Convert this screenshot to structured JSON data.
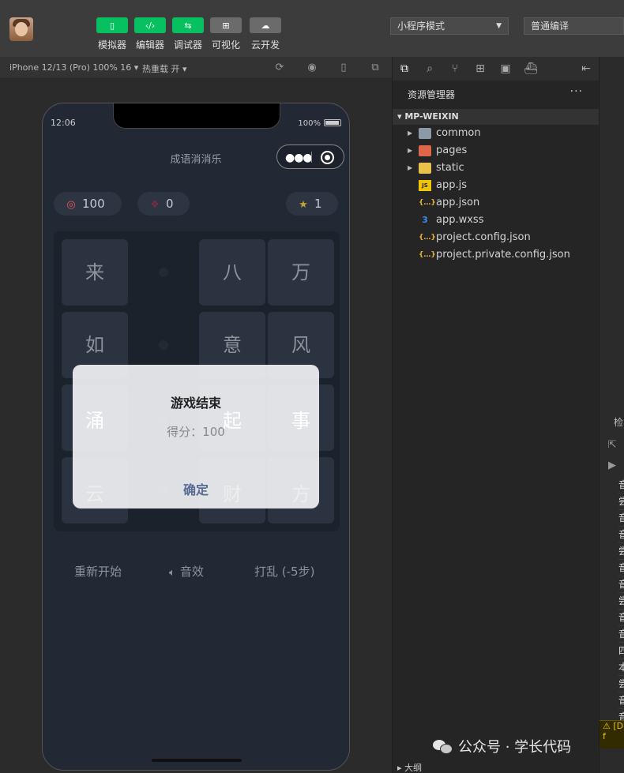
{
  "toolbar": {
    "tools": [
      {
        "label": "模拟器",
        "icon": "phone-icon"
      },
      {
        "label": "编辑器",
        "icon": "code-icon"
      },
      {
        "label": "调试器",
        "icon": "debug-icon"
      },
      {
        "label": "可视化",
        "icon": "layout-icon"
      },
      {
        "label": "云开发",
        "icon": "cloud-icon"
      }
    ],
    "mode_select": "小程序模式",
    "compile_select": "普通编译"
  },
  "simulator_bar": {
    "device": "iPhone 12/13 (Pro) 100% 16 ▾",
    "hot_reload": "热重载 开 ▾"
  },
  "phone": {
    "time": "12:06",
    "battery": "100%",
    "nav_title": "成语消消乐",
    "stats": {
      "score": "100",
      "combo": "0",
      "stars": "1"
    },
    "board": [
      [
        "来",
        "",
        "八",
        "万"
      ],
      [
        "如",
        "",
        "意",
        "风"
      ],
      [
        "涌",
        "",
        "起",
        "事"
      ],
      [
        "云",
        "",
        "财",
        "方"
      ]
    ],
    "modal": {
      "title": "游戏结束",
      "score_text": "得分：100",
      "confirm": "确定"
    },
    "actions": {
      "restart": "重新开始",
      "sound": "音效",
      "shuffle": "打乱 (-5步)"
    }
  },
  "explorer": {
    "header": "资源管理器",
    "project": "MP-WEIXIN",
    "items": [
      {
        "name": "common",
        "type": "folder",
        "icon": "folder-icon"
      },
      {
        "name": "pages",
        "type": "folder",
        "icon": "pages-folder-icon"
      },
      {
        "name": "static",
        "type": "folder",
        "icon": "static-folder-icon"
      },
      {
        "name": "app.js",
        "type": "file",
        "icon": "js-file-icon"
      },
      {
        "name": "app.json",
        "type": "file",
        "icon": "json-file-icon"
      },
      {
        "name": "app.wxss",
        "type": "file",
        "icon": "css-file-icon"
      },
      {
        "name": "project.config.json",
        "type": "file",
        "icon": "json-file-icon"
      },
      {
        "name": "project.private.config.json",
        "type": "file",
        "icon": "json-file-icon"
      }
    ],
    "outline": "▸ 大纲"
  },
  "right_panel": {
    "tab": "检",
    "rows": [
      "音",
      "尝",
      "音",
      "音",
      "尝",
      "音",
      "音",
      "尝",
      "音",
      "音",
      "四",
      "本",
      "尝",
      "音",
      "音"
    ],
    "warning": "[D f"
  },
  "watermark": "公众号 · 学长代码",
  "colors": {
    "accent": "#07c160",
    "modal_confirm": "#576b95",
    "phone_bg": "#222834"
  }
}
